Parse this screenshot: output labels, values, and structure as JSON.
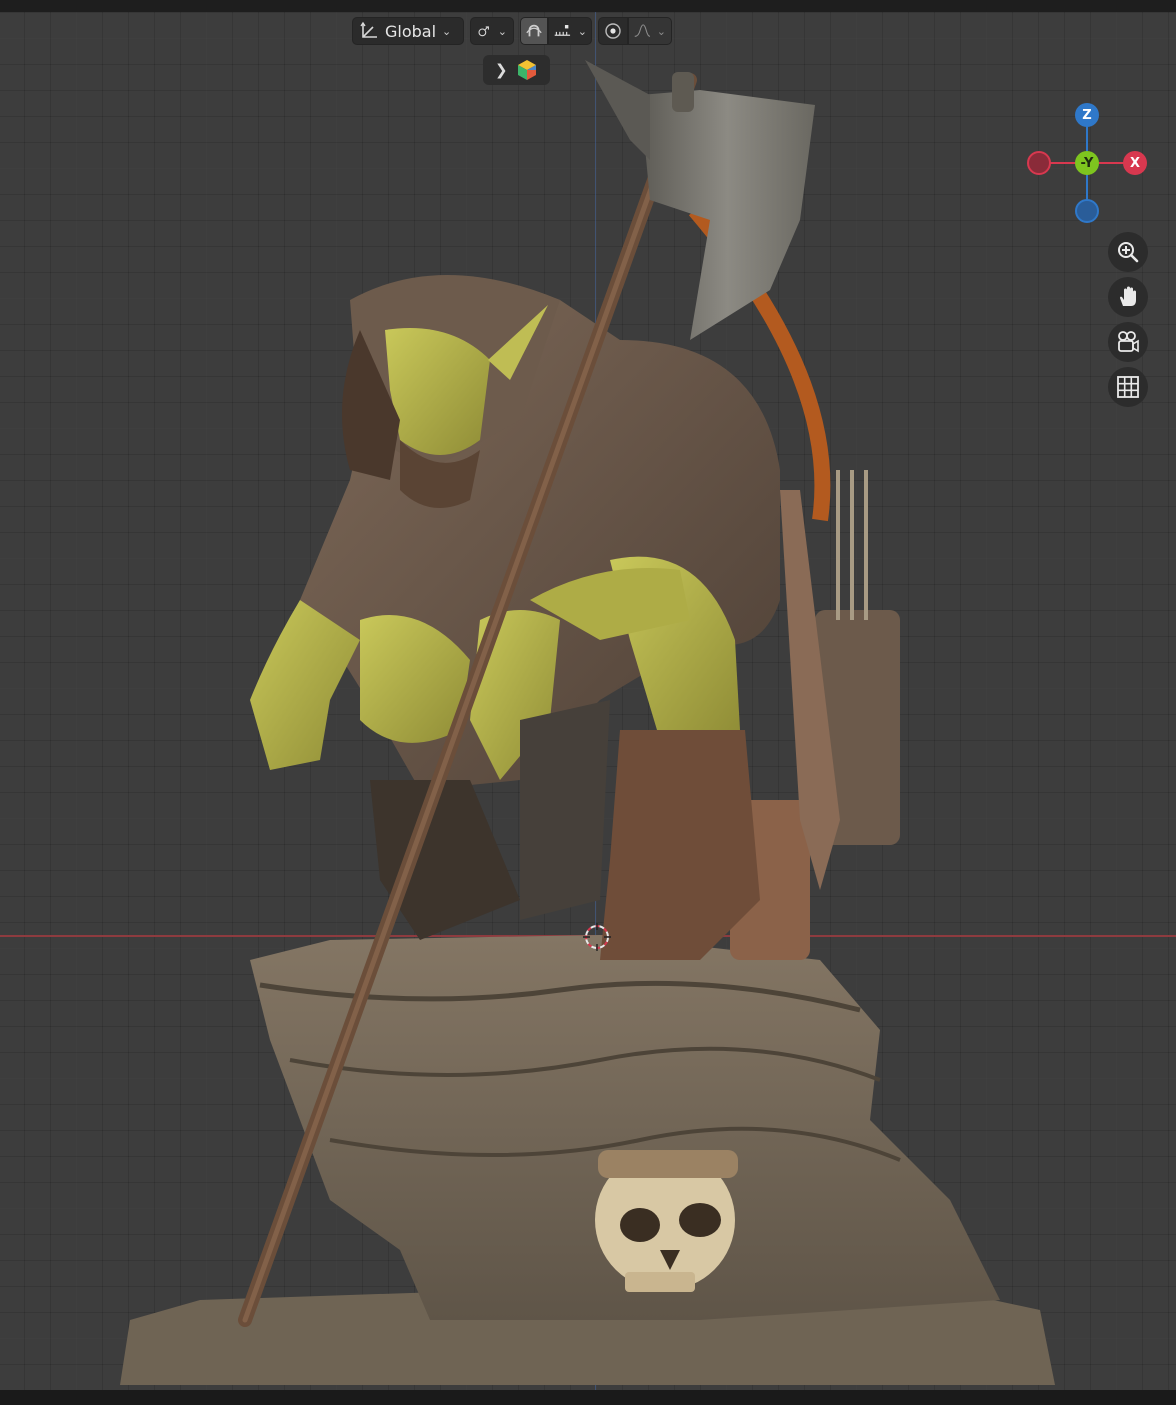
{
  "header": {
    "transform_orientation": "Global",
    "transform_icon": "transform-orientation-icon",
    "pivot_icon": "pivot-link-icon",
    "snap_icon": "magnet-snap-icon",
    "snap_increment_icon": "snap-increment-icon",
    "proportional_icon": "proportional-edit-icon",
    "falloff_icon": "falloff-curve-icon"
  },
  "popover": {
    "expand_icon": "chevron-right-icon",
    "object_icon": "object-color-cube-icon"
  },
  "gizmo": {
    "z_label": "Z",
    "y_label": "-Y",
    "x_label": "X",
    "colors": {
      "x": "#d8384f",
      "y": "#7ec51f",
      "z": "#2f78c9"
    }
  },
  "nav_buttons": [
    "zoom-icon",
    "pan-hand-icon",
    "camera-view-icon",
    "grid-ortho-icon"
  ],
  "colors": {
    "viewport_bg": "#3d3d3d",
    "skin": "#b5b34c",
    "leather": "#6e5a4b",
    "stone": "#7a6d5e",
    "bone": "#d7c7a5",
    "bow": "#b35a1f"
  }
}
